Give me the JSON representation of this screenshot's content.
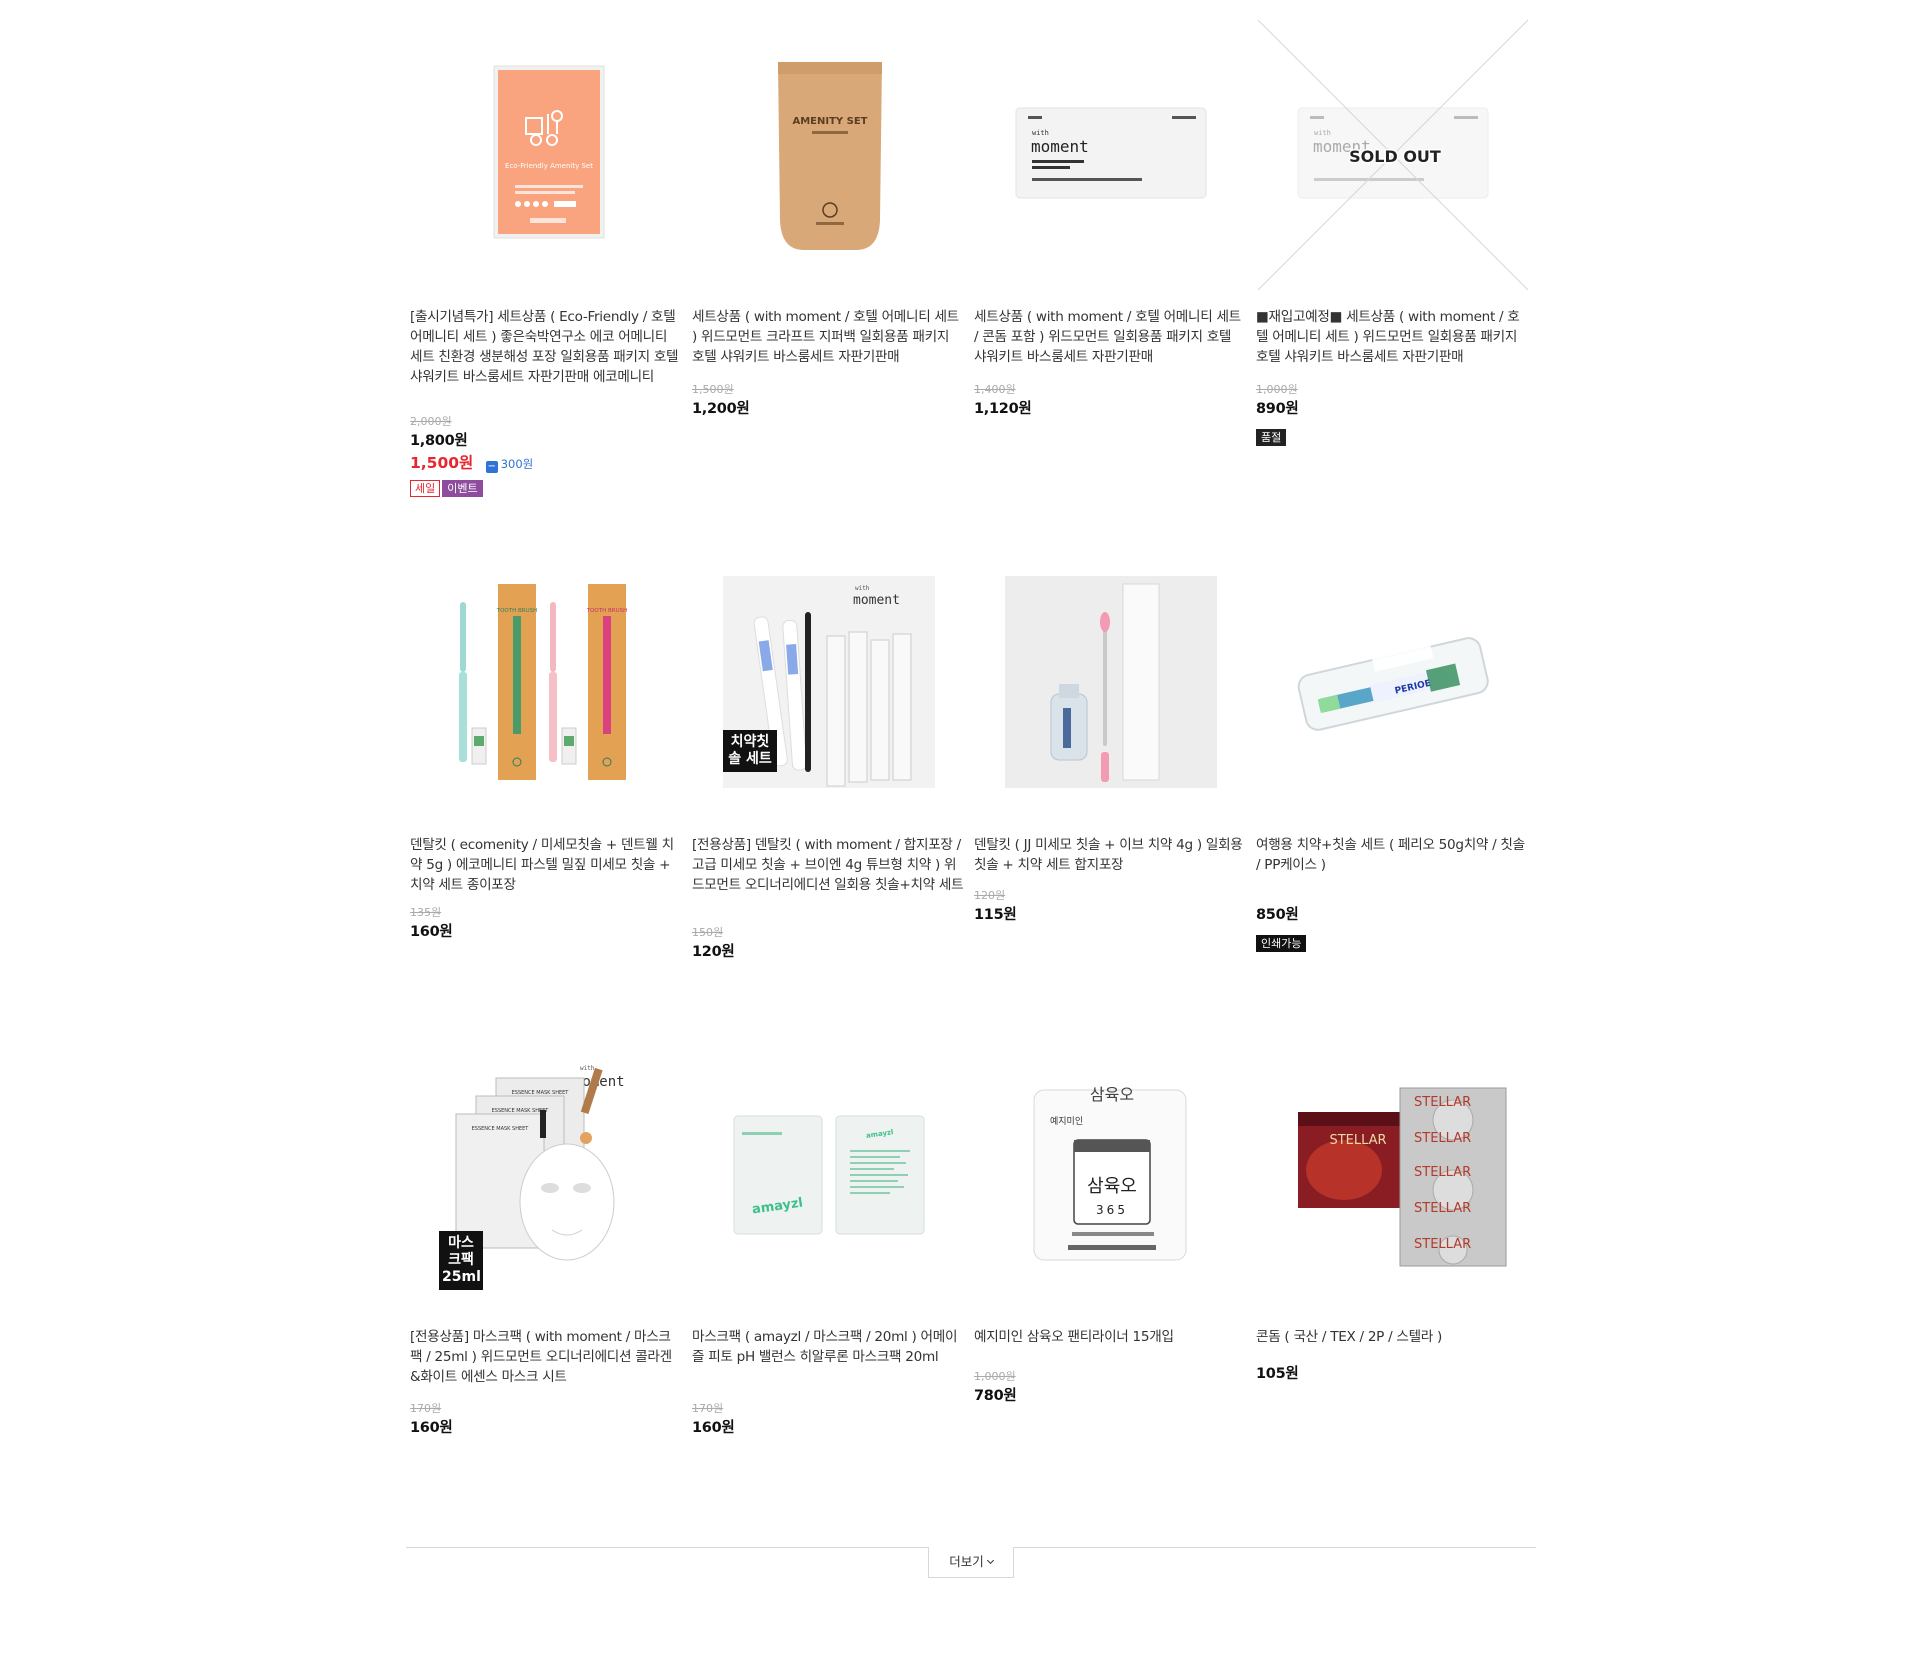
{
  "products": [
    {
      "name": "[출시기념특가] 세트상품 ( Eco-Friendly / 호텔 어메니티 세트 ) 좋은숙박연구소 에코 어메니티 세트 친환경 생분해성 포장 일회용품 패키지 호텔 샤워키트 바스룸세트 자판기판매 에코메니티",
      "original_price": "2,000원",
      "price": "1,800원",
      "sale_price": "1,500원",
      "coupon": "300원",
      "badges": [
        "세일",
        "이벤트"
      ],
      "image": {
        "title": "Eco-Friendly Amenity Set"
      }
    },
    {
      "name": "세트상품 ( with moment / 호텔 어메니티 세트 ) 위드모먼트 크라프트 지퍼백 일회용품 패키지 호텔 샤워키트 바스룸세트 자판기판매",
      "original_price": "1,500원",
      "price": "1,200원",
      "image": {
        "title": "AMENITY SET"
      }
    },
    {
      "name": "세트상품 ( with moment / 호텔 어메니티 세트 / 콘돔 포함 ) 위드모먼트 일회용품 패키지 호텔 샤워키트 바스룸세트 자판기판매",
      "original_price": "1,400원",
      "price": "1,120원",
      "image": {
        "brand_small": "with",
        "brand": "moment"
      }
    },
    {
      "name": "■재입고예정■ 세트상품 ( with moment / 호텔 어메니티 세트 ) 위드모먼트 일회용품 패키지 호텔 샤워키트 바스룸세트 자판기판매",
      "original_price": "1,000원",
      "price": "890원",
      "badges": [
        "품절"
      ],
      "image": {
        "brand_small": "with",
        "brand": "moment",
        "overlay": "SOLD OUT"
      }
    },
    {
      "name": "덴탈킷 ( ecomenity / 미세모칫솔 + 덴트웰 치약 5g ) 에코메니티 파스텔 밀짚 미세모 칫솔 + 치약 세트 종이포장",
      "original_price": "135원",
      "price": "160원",
      "image": {
        "box_text": "TOOTH BRUSH"
      }
    },
    {
      "name": "[전용상품] 덴탈킷 ( with moment / 합지포장 / 고급 미세모 칫솔 + 브이엔 4g 튜브형 치약 ) 위드모먼트 오디너리에디션 일회용 칫솔+치약 세트",
      "original_price": "150원",
      "price": "120원",
      "image": {
        "brand_small": "with",
        "brand": "moment",
        "tag": "치약칫솔 세트"
      }
    },
    {
      "name": "덴탈킷 ( JJ 미세모 칫솔 + 이브 치약 4g ) 일회용 칫솔 + 치약 세트 합지포장",
      "original_price": "120원",
      "price": "115원"
    },
    {
      "name": "여행용 치약+칫솔 세트 ( 페리오 50g치약 / 칫솔 / PP케이스 )",
      "price": "850원",
      "badges": [
        "인쇄가능"
      ],
      "image": {
        "label": "PERIOE"
      }
    },
    {
      "name": "[전용상품] 마스크팩 ( with moment / 마스크팩 / 25ml ) 위드모먼트 오디너리에디션 콜라겐&화이트 에센스 마스크 시트",
      "original_price": "170원",
      "price": "160원",
      "image": {
        "brand_small": "with",
        "brand": "moment",
        "sheet_label": "ESSENCE MASK SHEET",
        "tag": "마스크팩 25ml"
      }
    },
    {
      "name": "마스크팩 ( amayzl / 마스크팩 / 20ml ) 어메이즐 피토 pH 밸런스 히알루론 마스크팩 20ml",
      "original_price": "170원",
      "price": "160원",
      "image": {
        "brand": "amayzl"
      }
    },
    {
      "name": "예지미인 삼육오 팬티라이너 15개입",
      "original_price": "1,000원",
      "price": "780원",
      "image": {
        "brand": "예지미인",
        "product": "삼육오",
        "number": "365"
      }
    },
    {
      "name": "콘돔 ( 국산 / TEX / 2P / 스텔라 )",
      "price": "105원",
      "image": {
        "brand": "STELLAR"
      }
    }
  ],
  "more_button": {
    "label": "더보기"
  },
  "colors": {
    "sale": "#e8262f",
    "coupon": "#2f73d6",
    "event": "#8e4c9e"
  }
}
